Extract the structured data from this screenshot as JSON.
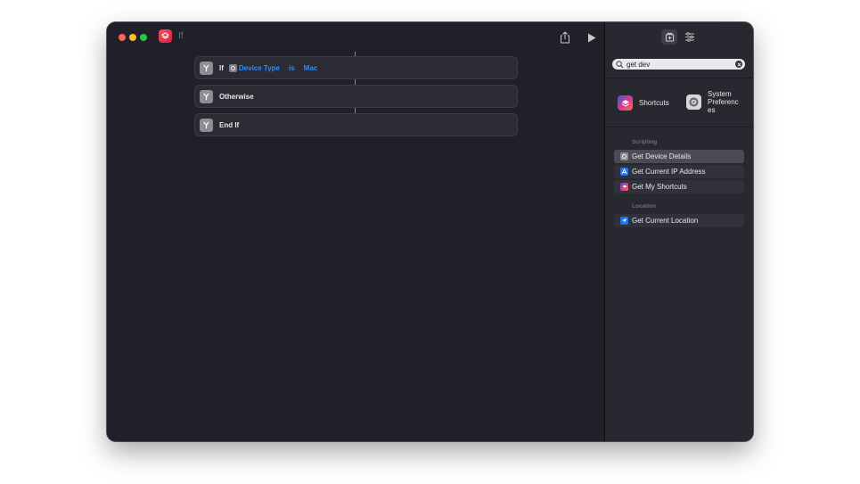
{
  "window": {
    "title": "If"
  },
  "editor": {
    "actions": [
      {
        "label": "If",
        "params": [
          "Device Type",
          "is",
          "Mac"
        ]
      },
      {
        "label": "Otherwise"
      },
      {
        "label": "End If"
      }
    ]
  },
  "sidebar": {
    "search": {
      "value": "get dev"
    },
    "apps": [
      {
        "name": "Shortcuts",
        "icon": "shortcuts-icon"
      },
      {
        "name": "System Preferenc es",
        "icon": "system-preferences-icon"
      }
    ],
    "sections": [
      {
        "title": "Scripting",
        "items": [
          {
            "label": "Get Device Details",
            "icon": "gear-icon",
            "selected": true
          },
          {
            "label": "Get Current IP Address",
            "icon": "network-icon",
            "selected": false
          },
          {
            "label": "Get My Shortcuts",
            "icon": "shortcuts-icon",
            "selected": false
          }
        ]
      },
      {
        "title": "Location",
        "items": [
          {
            "label": "Get Current Location",
            "icon": "location-arrow-icon",
            "selected": false
          }
        ]
      }
    ]
  },
  "colors": {
    "accent": "#2d8cff",
    "background": "#1f2028",
    "sidebar": "#282930"
  }
}
